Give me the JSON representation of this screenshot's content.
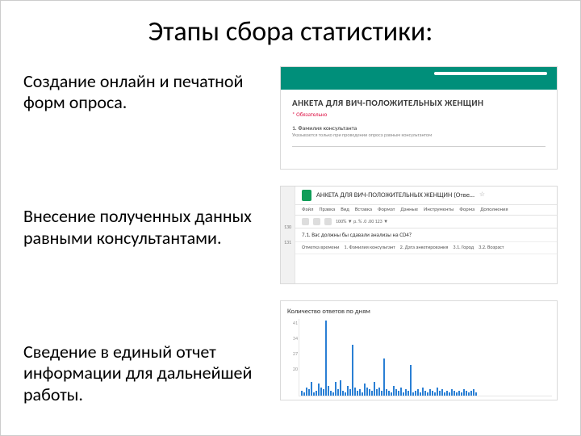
{
  "title": "Этапы сбора статистики:",
  "steps": {
    "s1": "Создание онлайн и печатной форм опроса.",
    "s2": "Внесение полученных данных равными консультантами.",
    "s3": "Сведение в единый отчет информации для дальнейшей работы."
  },
  "form": {
    "title": "АНКЕТА ДЛЯ ВИЧ-ПОЛОЖИТЕЛЬНЫХ ЖЕНЩИН",
    "required": "* Обязательно",
    "q1": "1. Фамилия консультанта",
    "q1_sub": "Указывается только при проведении опроса равным консультантом"
  },
  "sheet": {
    "doc_title": "АНКЕТА ДЛЯ ВИЧ-ПОЛОЖИТЕЛЬНЫХ ЖЕНЩИН (Отве…",
    "menu": [
      "Файл",
      "Правка",
      "Вид",
      "Вставка",
      "Формат",
      "Данные",
      "Инструменты",
      "Форма",
      "Дополнения"
    ],
    "toolbar_text": "100%  ▼   р.   %   .0   .00   123 ▼",
    "active_cell": "7.1. Вас должны бы сдавали анализы на СD4?",
    "headers": [
      "Отметка времени",
      "1. Фамилия консультант",
      "2. Дата анкетирования",
      "3.1. Город",
      "3.2. Возраст"
    ],
    "rows": [
      "130",
      "131"
    ]
  },
  "chart_data": {
    "type": "bar",
    "title": "Количество ответов по дням",
    "ylabel": "",
    "xlabel": "",
    "ylim": [
      0,
      45
    ],
    "yticks": [
      41,
      34,
      27,
      20
    ],
    "values": [
      3,
      2,
      5,
      4,
      8,
      2,
      3,
      7,
      5,
      4,
      44,
      6,
      3,
      2,
      8,
      4,
      9,
      3,
      2,
      6,
      4,
      30,
      5,
      3,
      4,
      2,
      7,
      5,
      4,
      3,
      8,
      4,
      5,
      3,
      22,
      4,
      3,
      2,
      6,
      4,
      3,
      5,
      2,
      4,
      3,
      18,
      2,
      3,
      4,
      2,
      5,
      3,
      2,
      4,
      3,
      2,
      5,
      3,
      4,
      2,
      3,
      2,
      4,
      3,
      2,
      3,
      2,
      4,
      3,
      2,
      3,
      4,
      2
    ]
  }
}
